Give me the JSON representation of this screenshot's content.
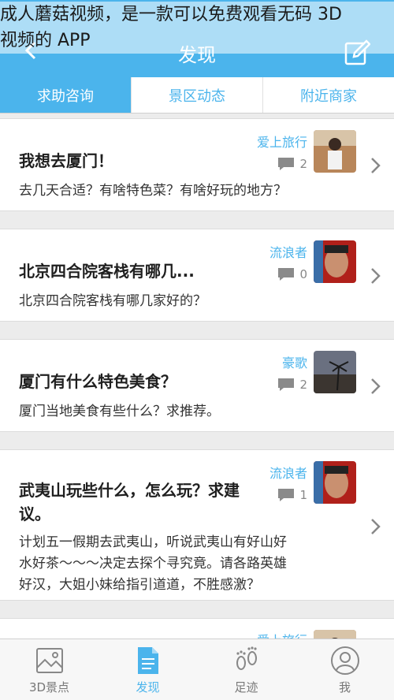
{
  "overlay": {
    "line1": "成人蘑菇视频，是一款可以免费观看无码 3D",
    "line2": "视频的 APP"
  },
  "header": {
    "title": "发现"
  },
  "tabs": [
    {
      "label": "求助咨询"
    },
    {
      "label": "景区动态"
    },
    {
      "label": "附近商家"
    }
  ],
  "posts": [
    {
      "user": "爱上旅行",
      "title": "我想去厦门！",
      "comments": "2",
      "desc": "去几天合适？有啥特色菜？有啥好玩的地方？"
    },
    {
      "user": "流浪者",
      "title": "北京四合院客栈有哪几...",
      "comments": "0",
      "desc": "北京四合院客栈有哪几家好的？"
    },
    {
      "user": "豪歌",
      "title": "厦门有什么特色美食？",
      "comments": "2",
      "desc": "厦门当地美食有些什么？求推荐。"
    },
    {
      "user": "流浪者",
      "title_line1": "武夷山玩些什么，怎么玩？求建",
      "title_line2": "议。",
      "comments": "1",
      "desc_line1": "计划五一假期去武夷山，听说武夷山有好山好",
      "desc_line2": "水好茶～～～决定去探个寻究竟。请各路英雄",
      "desc_line3": "好汉，大姐小妹给指引道道，不胜感激？"
    },
    {
      "user": "爱上旅行"
    }
  ],
  "nav": [
    {
      "label": "3D景点",
      "icon": "image-icon"
    },
    {
      "label": "发现",
      "icon": "document-icon"
    },
    {
      "label": "足迹",
      "icon": "footprints-icon"
    },
    {
      "label": "我",
      "icon": "user-icon"
    }
  ],
  "colors": {
    "accent": "#4bb4ec",
    "background": "#ececec"
  }
}
